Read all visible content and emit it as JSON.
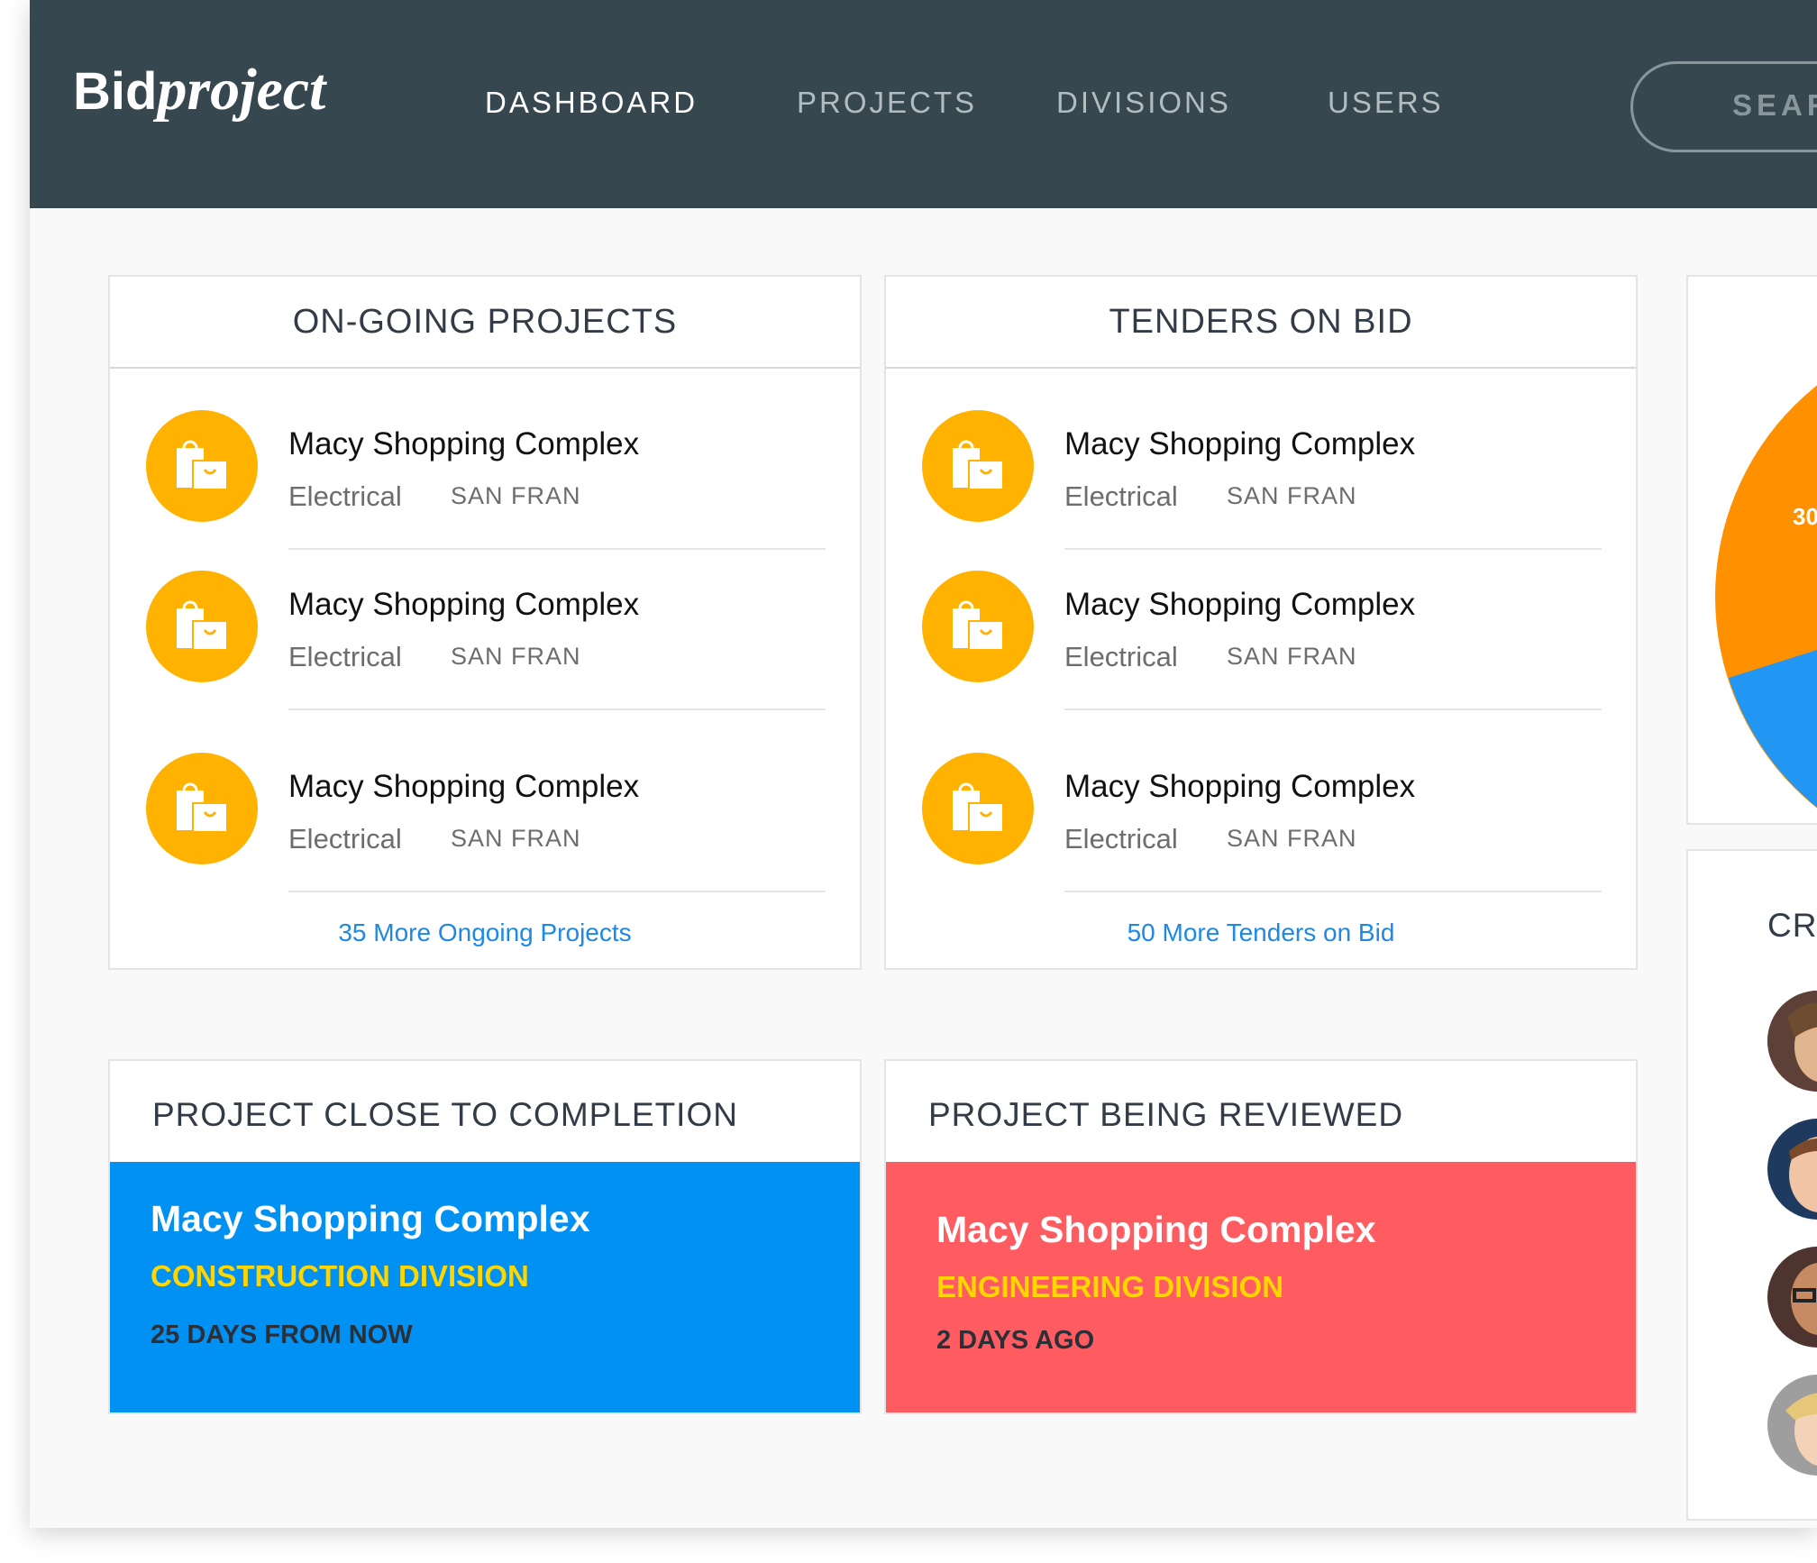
{
  "brand": {
    "part1": "Bid",
    "part2": "project"
  },
  "nav": {
    "items": [
      "DASHBOARD",
      "PROJECTS",
      "DIVISIONS",
      "USERS"
    ],
    "active": "DASHBOARD",
    "search_label": "SEARCH"
  },
  "ongoing": {
    "title": "ON-GOING PROJECTS",
    "items": [
      {
        "name": "Macy Shopping Complex",
        "category": "Electrical",
        "location": "SAN FRAN",
        "icon": "shopping-bags-icon"
      },
      {
        "name": "Macy Shopping Complex",
        "category": "Electrical",
        "location": "SAN FRAN",
        "icon": "shopping-bags-icon"
      },
      {
        "name": "Macy Shopping Complex",
        "category": "Electrical",
        "location": "SAN FRAN",
        "icon": "shopping-bags-icon"
      }
    ],
    "more_link": "35 More Ongoing Projects"
  },
  "tenders": {
    "title": "TENDERS ON BID",
    "items": [
      {
        "name": "Macy Shopping Complex",
        "category": "Electrical",
        "location": "SAN FRAN",
        "icon": "shopping-bags-icon"
      },
      {
        "name": "Macy Shopping Complex",
        "category": "Electrical",
        "location": "SAN FRAN",
        "icon": "shopping-bags-icon"
      },
      {
        "name": "Macy Shopping Complex",
        "category": "Electrical",
        "location": "SAN FRAN",
        "icon": "shopping-bags-icon"
      }
    ],
    "more_link": "50 More Tenders on Bid"
  },
  "completion": {
    "title": "PROJECT CLOSE TO COMPLETION",
    "project": "Macy Shopping Complex",
    "division": "CONSTRUCTION DIVISION",
    "time": "25 DAYS FROM NOW"
  },
  "review": {
    "title": "PROJECT BEING REVIEWED",
    "project": "Macy Shopping Complex",
    "division": "ENGINEERING DIVISION",
    "time": "2 DAYS AGO"
  },
  "pie_widget": {
    "visible_label": "30",
    "colors": [
      "#ff9100",
      "#2196f3"
    ]
  },
  "creators": {
    "title": "CREATORS"
  },
  "colors": {
    "navbar": "#37474f",
    "icon_bg": "#ffb300",
    "link": "#1e88e5",
    "completion_bg": "#0091f2",
    "review_bg": "#ff5c61",
    "division_text": "#ffd600"
  }
}
